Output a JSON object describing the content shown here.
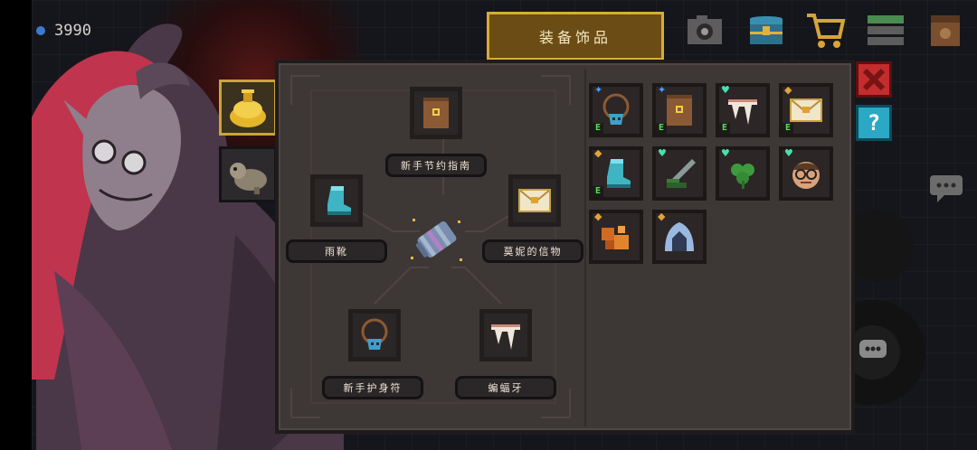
{
  "hud": {
    "currency_value": "3990"
  },
  "header": {
    "tab_title": "装备饰品"
  },
  "top_icons": [
    "camera-icon",
    "chest-icon",
    "shop-cart-icon",
    "menu-list-icon",
    "backpack-icon"
  ],
  "side_tabs": [
    {
      "name": "gold-pot-icon",
      "active": true
    },
    {
      "name": "pet-icon",
      "active": false
    }
  ],
  "equipped": {
    "top": {
      "label": "新手节约指南",
      "icon": "guidebook-icon"
    },
    "left": {
      "label": "雨靴",
      "icon": "boot-icon"
    },
    "right": {
      "label": "莫妮的信物",
      "icon": "letter-icon"
    },
    "bottom_left": {
      "label": "新手护身符",
      "icon": "amulet-icon"
    },
    "bottom_right": {
      "label": "蝙蝠牙",
      "icon": "bat-fang-icon"
    },
    "center": {
      "icon": "scroll-core-icon"
    }
  },
  "inventory": [
    {
      "icon": "amulet-icon",
      "mark": "star",
      "equipped_badge": "E"
    },
    {
      "icon": "guidebook-icon",
      "mark": "star",
      "equipped_badge": "E"
    },
    {
      "icon": "bat-fang-icon",
      "mark": "heart",
      "equipped_badge": "E"
    },
    {
      "icon": "letter-icon",
      "mark": "shield",
      "equipped_badge": "E"
    },
    {
      "icon": "boot-icon",
      "mark": "shield",
      "equipped_badge": "E"
    },
    {
      "icon": "sword-icon",
      "mark": "heart",
      "equipped_badge": ""
    },
    {
      "icon": "clover-icon",
      "mark": "heart",
      "equipped_badge": ""
    },
    {
      "icon": "glasses-face-icon",
      "mark": "heart",
      "equipped_badge": ""
    },
    {
      "icon": "gem-cluster-icon",
      "mark": "shield",
      "equipped_badge": ""
    },
    {
      "icon": "hood-icon",
      "mark": "shield",
      "equipped_badge": ""
    }
  ],
  "buttons": {
    "help_label": "?"
  },
  "colors": {
    "gold": "#d6ad35",
    "close": "#c42d2d",
    "help": "#2aa8c4",
    "equip_badge": "#58e05a"
  }
}
